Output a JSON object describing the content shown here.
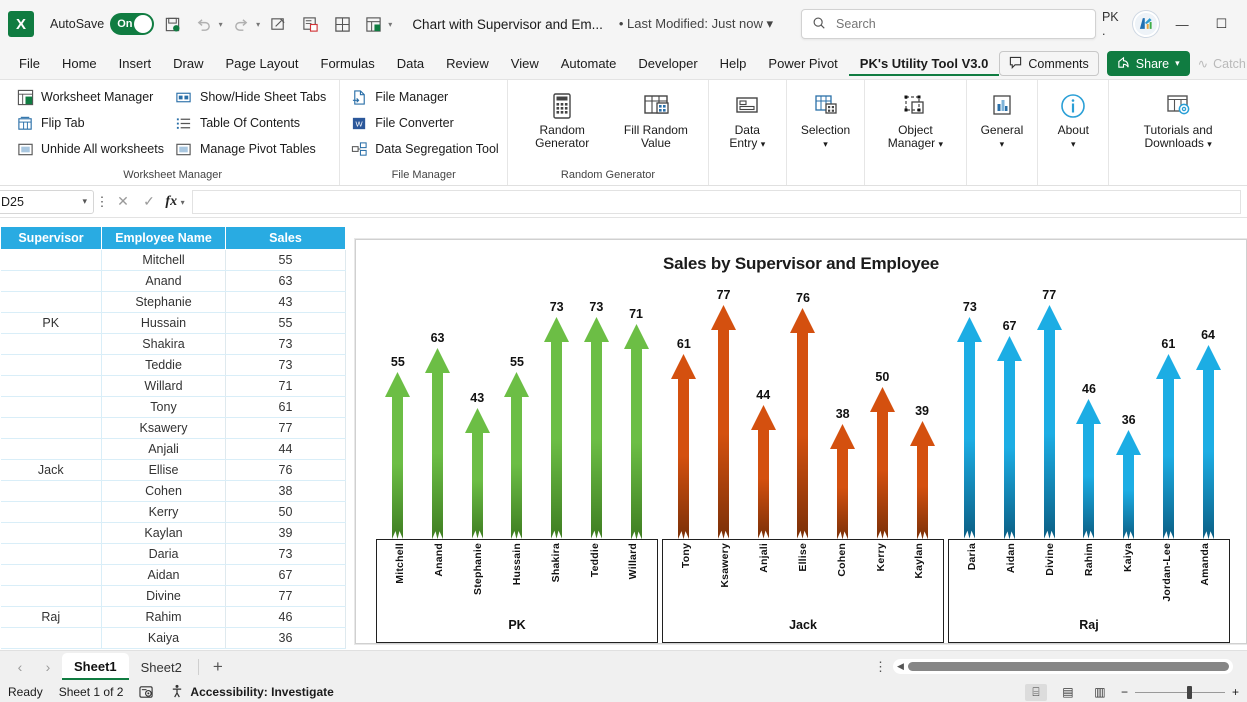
{
  "titlebar": {
    "autosave_label": "AutoSave",
    "autosave_state": "On",
    "doc_title": "Chart with Supervisor and Em...",
    "modified": "• Last Modified: Just now",
    "search_placeholder": "Search",
    "user_initials": "PK .",
    "qat": [
      {
        "name": "save-icon",
        "glyph": "💾"
      },
      {
        "name": "undo-icon",
        "glyph": "↶"
      },
      {
        "name": "redo-icon",
        "glyph": "↷"
      },
      {
        "name": "touch-mode-icon",
        "glyph": "✍"
      },
      {
        "name": "print-preview-icon",
        "glyph": "🖼"
      },
      {
        "name": "borders-icon",
        "glyph": "⊞"
      },
      {
        "name": "new-sheet-icon",
        "glyph": "☷"
      },
      {
        "name": "customize-qat-icon",
        "glyph": "⌄"
      }
    ],
    "window_buttons": [
      "—",
      "❐"
    ]
  },
  "ribbon_tabs": {
    "items": [
      "File",
      "Home",
      "Insert",
      "Draw",
      "Page Layout",
      "Formulas",
      "Data",
      "Review",
      "View",
      "Automate",
      "Developer",
      "Help",
      "Power Pivot",
      "PK's Utility Tool V3.0"
    ],
    "active": "PK's Utility Tool V3.0",
    "comments_label": "Comments",
    "share_label": "Share",
    "catchup_label": "Catch"
  },
  "ribbon": {
    "groups": [
      {
        "label": "Worksheet Manager",
        "columns": [
          [
            {
              "label": "Worksheet Manager",
              "icon": "worksheet-manager-icon"
            },
            {
              "label": "Flip Tab",
              "icon": "flip-tab-icon"
            },
            {
              "label": "Unhide All worksheets",
              "icon": "unhide-worksheets-icon"
            }
          ],
          [
            {
              "label": "Show/Hide Sheet Tabs",
              "icon": "show-hide-sheet-tabs-icon"
            },
            {
              "label": "Table Of Contents",
              "icon": "table-of-contents-icon"
            },
            {
              "label": "Manage Pivot Tables",
              "icon": "manage-pivot-tables-icon"
            }
          ]
        ]
      },
      {
        "label": "File Manager",
        "columns": [
          [
            {
              "label": "File Manager",
              "icon": "file-manager-icon"
            },
            {
              "label": "File Converter",
              "icon": "file-converter-icon"
            },
            {
              "label": "Data Segregation Tool",
              "icon": "data-segregation-icon"
            }
          ]
        ]
      },
      {
        "label": "Random Generator",
        "buttons": [
          {
            "label": "Random Generator",
            "icon": "calculator-icon",
            "caret": false
          },
          {
            "label": "Fill Random Value",
            "icon": "fill-random-icon",
            "caret": false
          }
        ]
      },
      {
        "label": "",
        "buttons": [
          {
            "label": "Data Entry",
            "icon": "data-entry-icon",
            "caret": true
          }
        ]
      },
      {
        "label": "",
        "buttons": [
          {
            "label": "Selection",
            "icon": "selection-icon",
            "caret": true
          }
        ]
      },
      {
        "label": "",
        "buttons": [
          {
            "label": "Object Manager",
            "icon": "object-manager-icon",
            "caret": true
          }
        ]
      },
      {
        "label": "",
        "buttons": [
          {
            "label": "General",
            "icon": "general-chart-icon",
            "caret": true
          }
        ]
      },
      {
        "label": "",
        "buttons": [
          {
            "label": "About",
            "icon": "about-info-icon",
            "caret": true
          }
        ]
      },
      {
        "label": "",
        "buttons": [
          {
            "label": "Tutorials and Downloads",
            "icon": "tutorials-downloads-icon",
            "caret": true
          }
        ]
      }
    ]
  },
  "formula_bar": {
    "name_box": "D25",
    "formula_value": "",
    "cancel_icon": "✕",
    "enter_icon": "✓",
    "fx_icon": "fx"
  },
  "sheet": {
    "headers": [
      "Supervisor",
      "Employee Name",
      "Sales"
    ],
    "rows": [
      {
        "supervisor": "",
        "name": "Mitchell",
        "sales": "55"
      },
      {
        "supervisor": "",
        "name": "Anand",
        "sales": "63"
      },
      {
        "supervisor": "",
        "name": "Stephanie",
        "sales": "43"
      },
      {
        "supervisor": "PK",
        "name": "Hussain",
        "sales": "55"
      },
      {
        "supervisor": "",
        "name": "Shakira",
        "sales": "73"
      },
      {
        "supervisor": "",
        "name": "Teddie",
        "sales": "73"
      },
      {
        "supervisor": "",
        "name": "Willard",
        "sales": "71"
      },
      {
        "supervisor": "",
        "name": "Tony",
        "sales": "61"
      },
      {
        "supervisor": "",
        "name": "Ksawery",
        "sales": "77"
      },
      {
        "supervisor": "",
        "name": "Anjali",
        "sales": "44"
      },
      {
        "supervisor": "Jack",
        "name": "Ellise",
        "sales": "76"
      },
      {
        "supervisor": "",
        "name": "Cohen",
        "sales": "38"
      },
      {
        "supervisor": "",
        "name": "Kerry",
        "sales": "50"
      },
      {
        "supervisor": "",
        "name": "Kaylan",
        "sales": "39"
      },
      {
        "supervisor": "",
        "name": "Daria",
        "sales": "73"
      },
      {
        "supervisor": "",
        "name": "Aidan",
        "sales": "67"
      },
      {
        "supervisor": "",
        "name": "Divine",
        "sales": "77"
      },
      {
        "supervisor": "Raj",
        "name": "Rahim",
        "sales": "46"
      },
      {
        "supervisor": "",
        "name": "Kaiya",
        "sales": "36"
      }
    ]
  },
  "chart_data": {
    "type": "bar",
    "title": "Sales by Supervisor and Employee",
    "xlabel": "",
    "ylabel": "",
    "ylim": [
      0,
      85
    ],
    "grid": false,
    "legend": "none",
    "marker_style": "arrow",
    "groups": [
      {
        "name": "PK",
        "color": "#6CBE45",
        "color_dark": "#3F7E22",
        "categories": [
          "Mitchell",
          "Anand",
          "Stephanie",
          "Hussain",
          "Shakira",
          "Teddie",
          "Willard"
        ],
        "values": [
          55,
          63,
          43,
          55,
          73,
          73,
          71
        ]
      },
      {
        "name": "Jack",
        "color": "#D4500F",
        "color_dark": "#7A3008",
        "categories": [
          "Tony",
          "Ksawery",
          "Anjali",
          "Ellise",
          "Cohen",
          "Kerry",
          "Kaylan"
        ],
        "values": [
          61,
          77,
          44,
          76,
          38,
          50,
          39
        ]
      },
      {
        "name": "Raj",
        "color": "#1CADE4",
        "color_dark": "#0B5E84",
        "categories": [
          "Daria",
          "Aidan",
          "Divine",
          "Rahim",
          "Kaiya",
          "Jordan-Lee",
          "Amanda"
        ],
        "values": [
          73,
          67,
          77,
          46,
          36,
          61,
          64
        ]
      }
    ]
  },
  "tabstrip": {
    "prev_icon": "‹",
    "next_icon": "›",
    "sheets": [
      "Sheet1",
      "Sheet2"
    ],
    "active_sheet": "Sheet1",
    "add_label": "+"
  },
  "statusbar": {
    "mode": "Ready",
    "sheet_count": "Sheet 1 of 2",
    "accessibility": "Accessibility: Investigate",
    "views": [
      {
        "name": "normal-view-icon",
        "glyph": "⌸",
        "active": true
      },
      {
        "name": "page-layout-view-icon",
        "glyph": "▤",
        "active": false
      },
      {
        "name": "page-break-view-icon",
        "glyph": "▥",
        "active": false
      }
    ],
    "zoom_minus": "−",
    "zoom_plus": "+"
  }
}
